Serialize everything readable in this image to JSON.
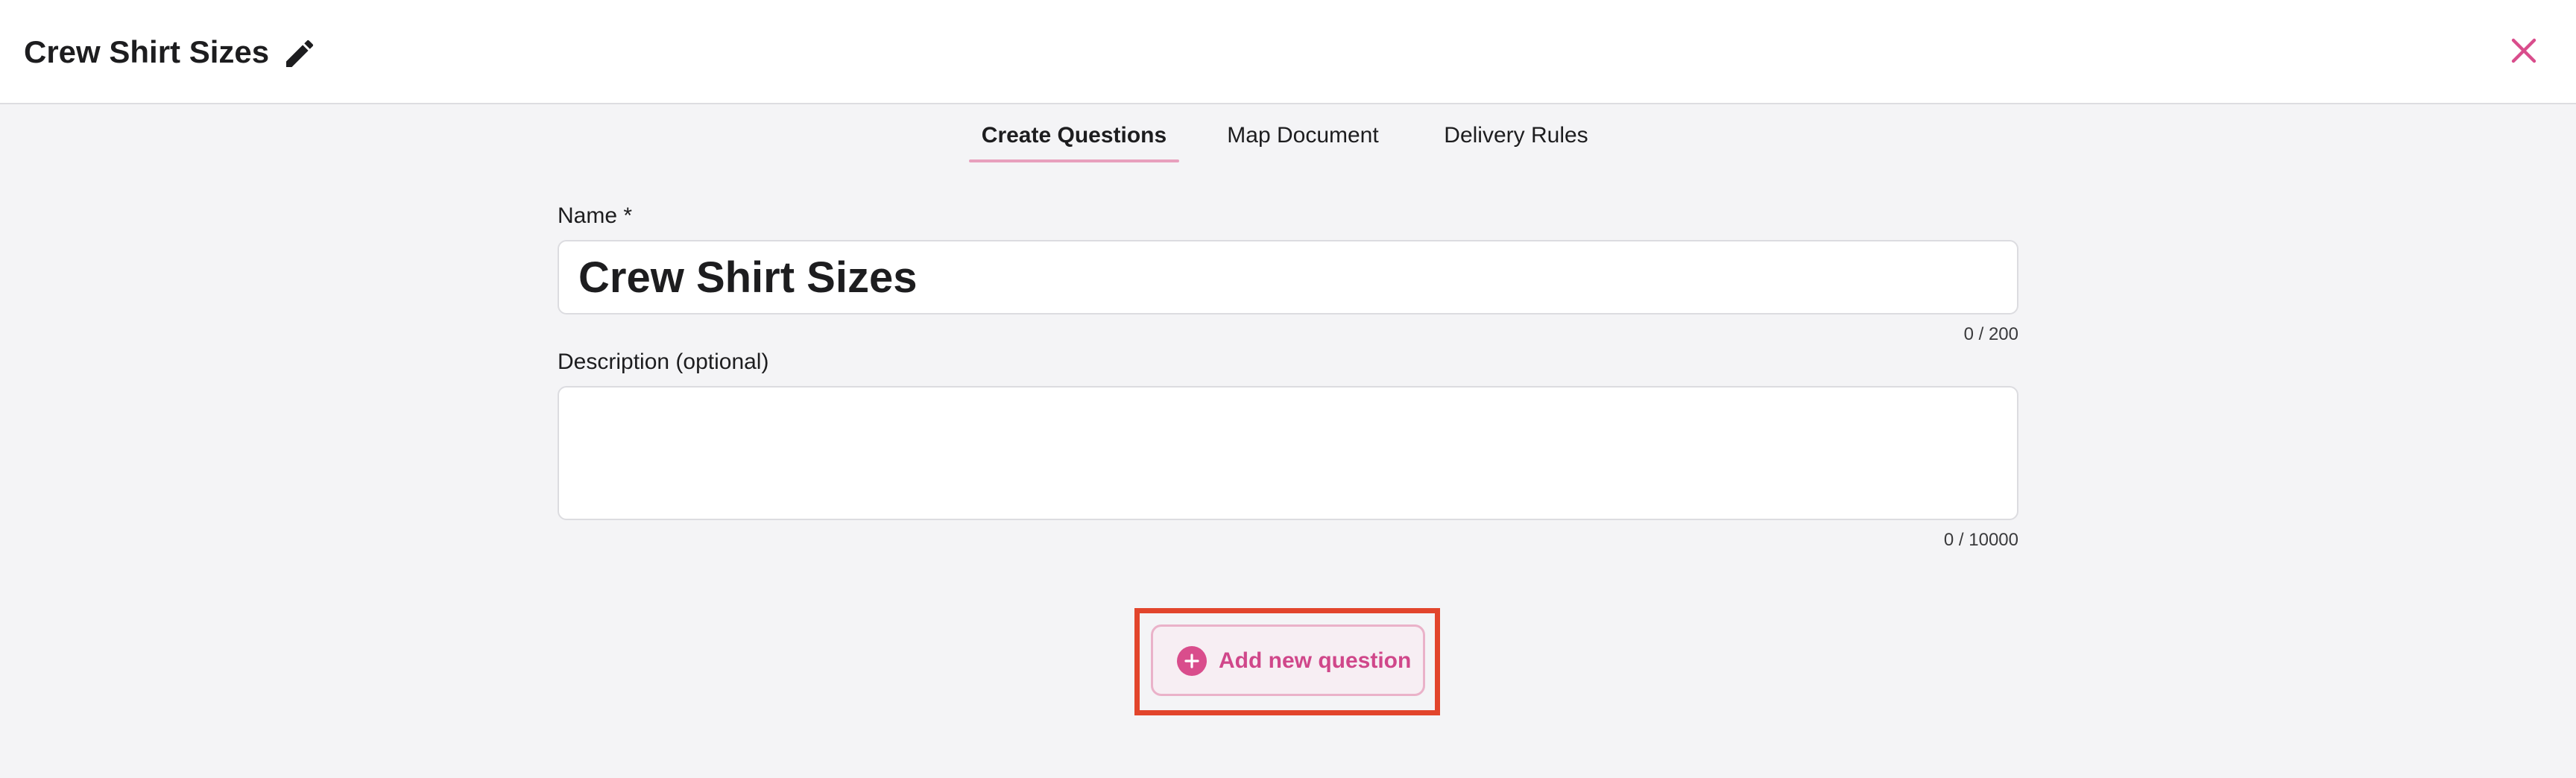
{
  "header": {
    "title": "Crew Shirt Sizes",
    "edit_icon": "pencil-icon",
    "close_icon": "close-icon"
  },
  "tabs": [
    {
      "label": "Create Questions",
      "active": true
    },
    {
      "label": "Map Document",
      "active": false
    },
    {
      "label": "Delivery Rules",
      "active": false
    }
  ],
  "form": {
    "name": {
      "label": "Name *",
      "value": "Crew Shirt Sizes",
      "counter": "0 / 200"
    },
    "description": {
      "label": "Description (optional)",
      "value": "",
      "counter": "0 / 10000"
    }
  },
  "actions": {
    "add_question_label": "Add new question",
    "add_question_icon": "plus-circle-icon"
  },
  "colors": {
    "accent": "#d94d8c",
    "highlight": "#e2452c",
    "background": "#f4f4f6"
  }
}
